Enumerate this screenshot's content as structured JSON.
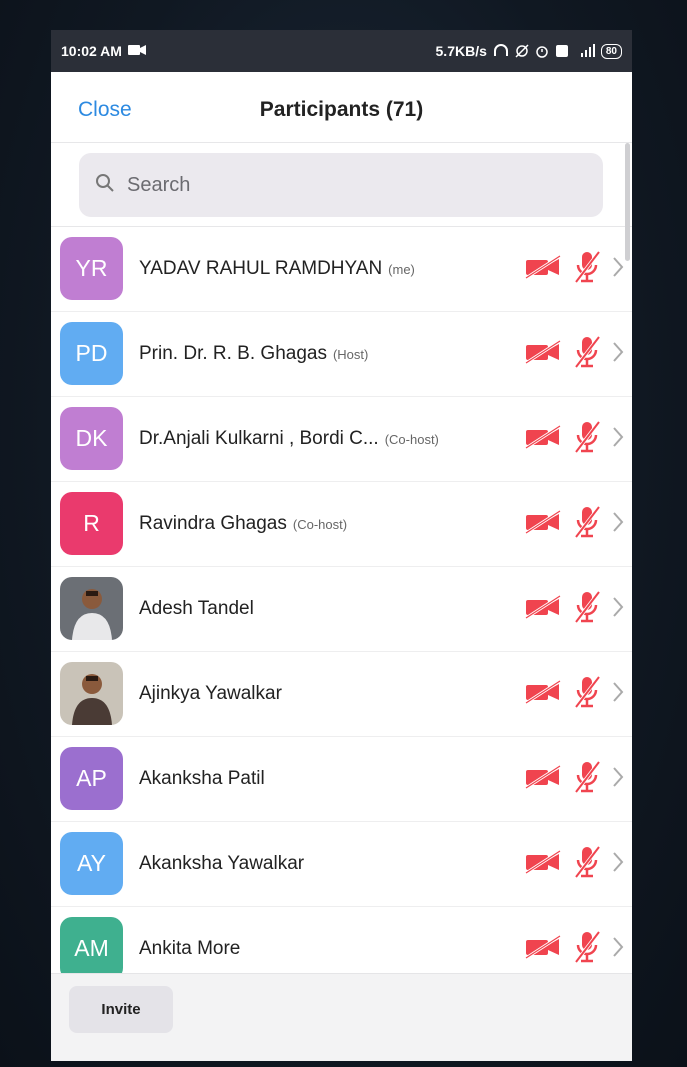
{
  "status_bar": {
    "time": "10:02 AM",
    "network_speed": "5.7KB/s",
    "battery": "80"
  },
  "header": {
    "close_label": "Close",
    "title": "Participants (71)"
  },
  "search": {
    "placeholder": "Search"
  },
  "participants": [
    {
      "initials": "YR",
      "name": "YADAV RAHUL RAMDHYAN",
      "role": "(me)",
      "avatar_color": "#c07ed2"
    },
    {
      "initials": "PD",
      "name": "Prin. Dr. R. B. Ghagas",
      "role": "(Host)",
      "avatar_color": "#61acf2"
    },
    {
      "initials": "DK",
      "name": "Dr.Anjali Kulkarni , Bordi C...",
      "role": "(Co-host)",
      "avatar_color": "#c07ed2"
    },
    {
      "initials": "R",
      "name": "Ravindra Ghagas",
      "role": "(Co-host)",
      "avatar_color": "#ea3a6d"
    },
    {
      "initials": "",
      "name": "Adesh Tandel",
      "role": "",
      "avatar_color": "photo"
    },
    {
      "initials": "",
      "name": "Ajinkya Yawalkar",
      "role": "",
      "avatar_color": "photo"
    },
    {
      "initials": "AP",
      "name": "Akanksha Patil",
      "role": "",
      "avatar_color": "#9b6fcf"
    },
    {
      "initials": "AY",
      "name": "Akanksha Yawalkar",
      "role": "",
      "avatar_color": "#61acf2"
    },
    {
      "initials": "AM",
      "name": "Ankita More",
      "role": "",
      "avatar_color": "#3fb08f"
    }
  ],
  "footer": {
    "invite_label": "Invite"
  },
  "colors": {
    "accent": "#2d8ae1",
    "muted_red": "#f0444f"
  },
  "icons": {
    "video": "video-off-icon",
    "audio": "mic-off-icon",
    "chevron": "chevron-right-icon"
  }
}
